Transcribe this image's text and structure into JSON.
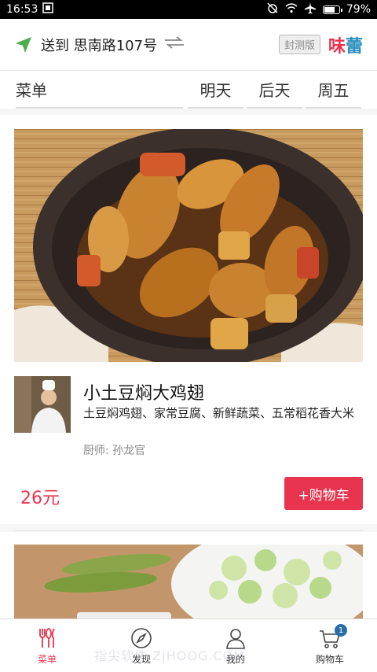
{
  "status_bar": {
    "time": "16:53",
    "battery": "79%",
    "battery_level": 0.79
  },
  "header": {
    "address_label": "送到 思南路107号",
    "beta_label": "封测版",
    "logo_part1": "味",
    "logo_part2": "蕾"
  },
  "tabs": {
    "menu_label": "菜单",
    "days": [
      "明天",
      "后天",
      "周五"
    ],
    "active_index": 0
  },
  "dish": {
    "name": "小土豆焖大鸡翅",
    "description": "土豆焖鸡翅、家常豆腐、新鲜蔬菜、五常稻花香大米",
    "chef_line": "厨师: 孙龙官",
    "price": "26元",
    "add_to_cart": "+购物车"
  },
  "bottom_nav": {
    "items": [
      {
        "label": "菜单",
        "icon": "cutlery-icon",
        "active": true
      },
      {
        "label": "发现",
        "icon": "compass-icon",
        "active": false
      },
      {
        "label": "我的",
        "icon": "user-icon",
        "active": false
      },
      {
        "label": "购物车",
        "icon": "cart-icon",
        "active": false
      }
    ],
    "cart_badge": "1"
  },
  "watermark": "指尖软件 ZJHOOG.COM",
  "colors": {
    "accent": "#e8344e",
    "location_icon": "#4caf50",
    "logo_blue": "#2a8fc2"
  }
}
